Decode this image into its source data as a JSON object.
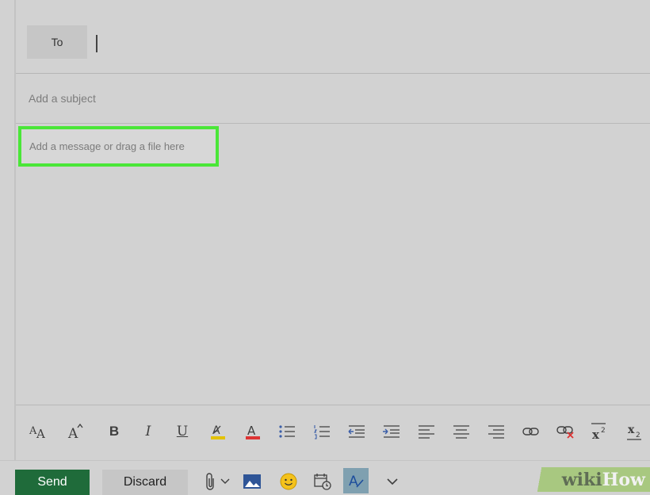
{
  "compose": {
    "to_label": "To",
    "subject_placeholder": "Add a subject",
    "body_placeholder": "Add a message or drag a file here"
  },
  "toolbar": {
    "icons": [
      "font-size-icon",
      "grow-font-icon",
      "bold-icon",
      "italic-icon",
      "underline-icon",
      "highlight-icon",
      "font-color-icon",
      "bullets-icon",
      "numbering-icon",
      "decrease-indent-icon",
      "increase-indent-icon",
      "align-left-icon",
      "align-center-icon",
      "align-right-icon",
      "link-icon",
      "remove-link-icon",
      "superscript-icon",
      "subscript-icon"
    ],
    "bold": "B",
    "italic": "I",
    "underline": "U"
  },
  "actions": {
    "send_label": "Send",
    "discard_label": "Discard"
  },
  "watermark": {
    "wiki": "wiki",
    "how": "How"
  },
  "colors": {
    "highlight_border": "#4ae638",
    "send_bg": "#1f6b3a",
    "font_color_red": "#d33",
    "highlighter_yellow": "#e3c200"
  }
}
